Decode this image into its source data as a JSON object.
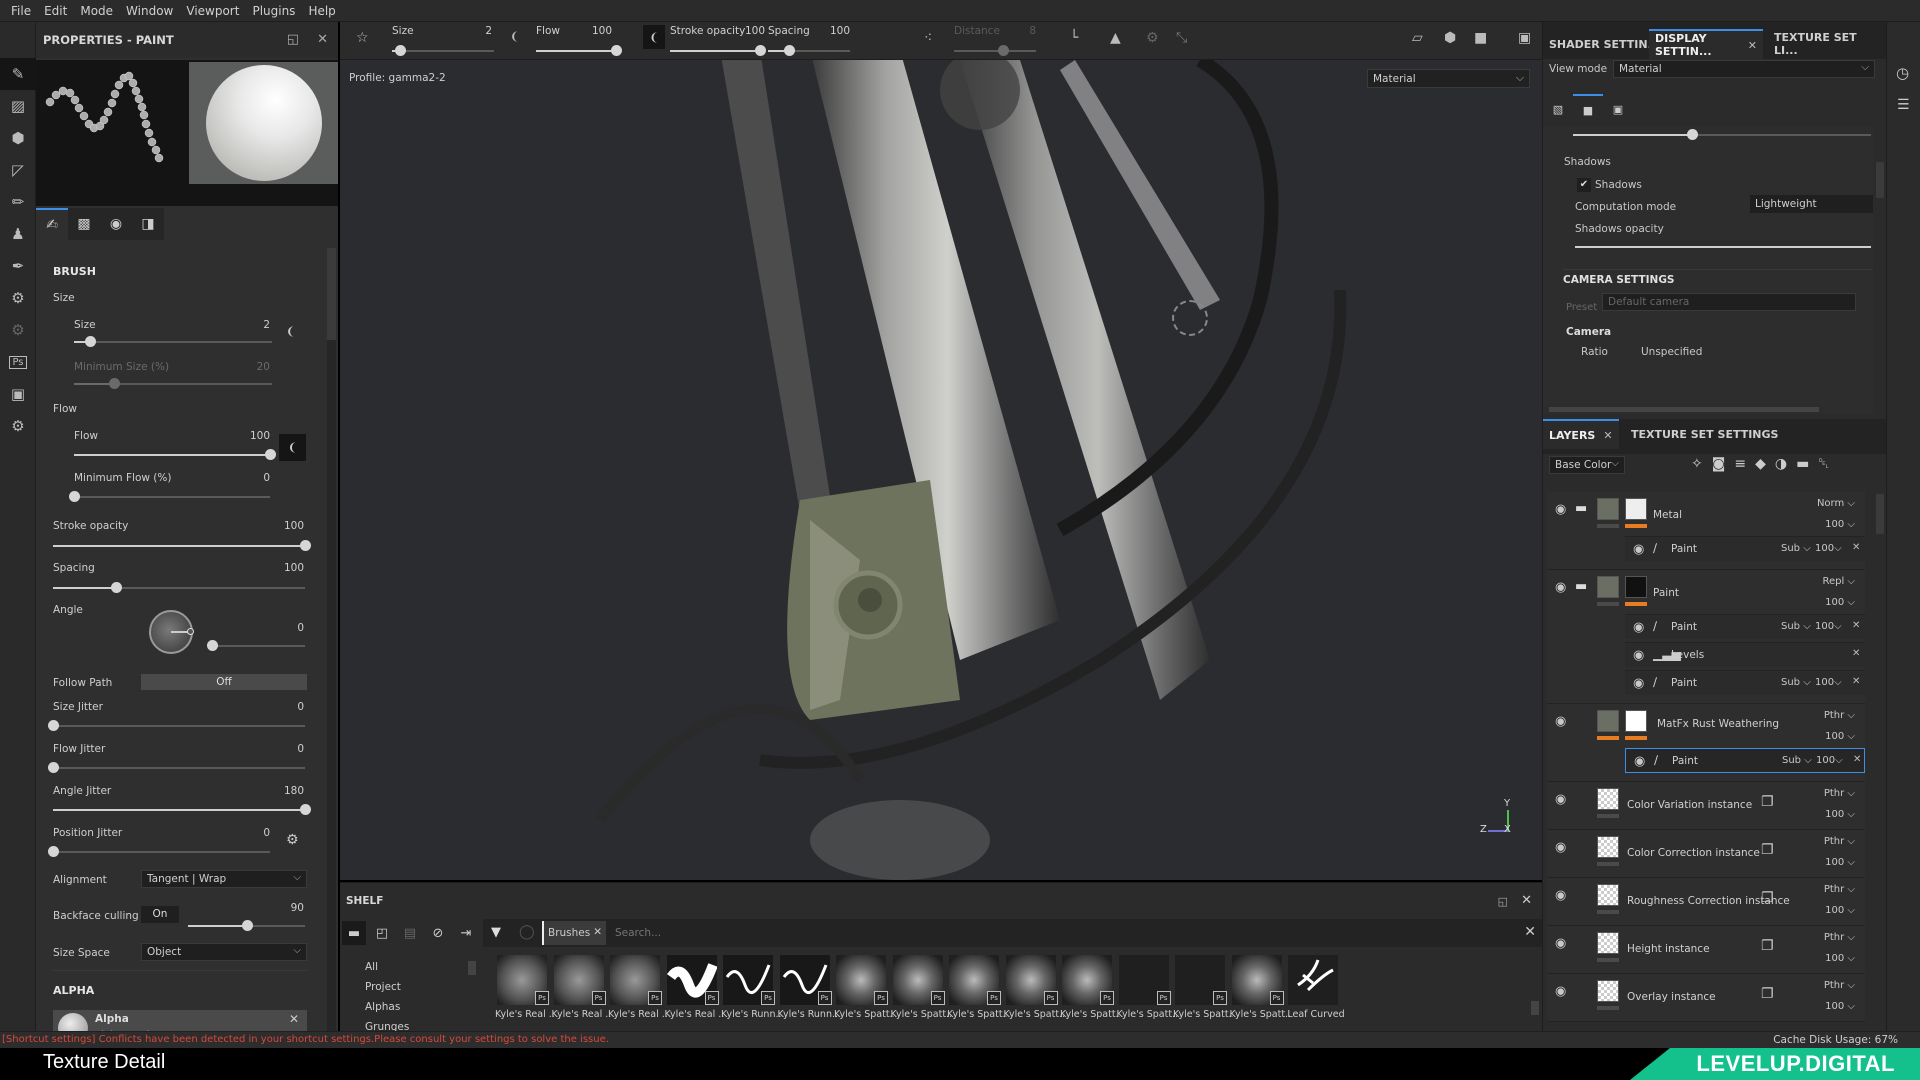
{
  "menu": [
    "File",
    "Edit",
    "Mode",
    "Window",
    "Viewport",
    "Plugins",
    "Help"
  ],
  "left_tools": [
    "paint-brush",
    "eraser",
    "projection",
    "polygon-fill",
    "smudge",
    "clone-stamp",
    "color-picker",
    "plugin-1",
    "plugin-2",
    "photoshop-export",
    "bake",
    "plugin-3"
  ],
  "properties": {
    "title": "PROPERTIES - PAINT",
    "tabs": [
      "brush-tab",
      "alpha-tab",
      "stencil-tab",
      "material-tab"
    ],
    "brush_section": "BRUSH",
    "size_group": "Size",
    "size_label": "Size",
    "size_value": "2",
    "size_frac": 0.08,
    "min_size_label": "Minimum Size (%)",
    "min_size_value": "20",
    "min_size_frac": 0.2,
    "flow_group": "Flow",
    "flow_label": "Flow",
    "flow_value": "100",
    "flow_frac": 1.0,
    "min_flow_label": "Minimum Flow (%)",
    "min_flow_value": "0",
    "min_flow_frac": 0,
    "stroke_opacity_label": "Stroke opacity",
    "stroke_opacity_value": "100",
    "stroke_opacity_frac": 1.0,
    "spacing_label": "Spacing",
    "spacing_value": "100",
    "spacing_frac": 0.25,
    "angle_label": "Angle",
    "angle_value": "0",
    "angle_frac": 0,
    "follow_path_label": "Follow Path",
    "follow_path_value": "Off",
    "size_jitter_label": "Size Jitter",
    "size_jitter_value": "0",
    "size_jitter_frac": 0,
    "flow_jitter_label": "Flow Jitter",
    "flow_jitter_value": "0",
    "flow_jitter_frac": 0,
    "angle_jitter_label": "Angle Jitter",
    "angle_jitter_value": "180",
    "angle_jitter_frac": 1.0,
    "position_jitter_label": "Position Jitter",
    "position_jitter_value": "0",
    "position_jitter_frac": 0,
    "alignment_label": "Alignment",
    "alignment_value": "Tangent | Wrap",
    "backface_label": "Backface culling",
    "backface_toggle": "On",
    "backface_value": "90",
    "backface_frac": 0.5,
    "size_space_label": "Size Space",
    "size_space_value": "Object",
    "alpha_section": "ALPHA",
    "alpha_name": "Alpha",
    "alpha_resource": "alpha_stroke_06"
  },
  "toolbar": {
    "size_label": "Size",
    "size_value": "2",
    "flow_label": "Flow",
    "flow_value": "100",
    "stroke_opacity_label": "Stroke opacity",
    "stroke_opacity_value": "100",
    "spacing_label": "Spacing",
    "spacing_value": "100",
    "distance_label": "Distance",
    "distance_value": "8"
  },
  "viewport": {
    "profile": "Profile: gamma2-2",
    "mode": "Material",
    "axis": {
      "y": "Y",
      "z": "Z",
      "x": "X"
    }
  },
  "shelf": {
    "title": "SHELF",
    "filter_tag": "Brushes",
    "search_placeholder": "Search...",
    "categories": [
      "All",
      "Project",
      "Alphas",
      "Grunges"
    ],
    "items": [
      "Kyle's Real ...",
      "Kyle's Real ...",
      "Kyle's Real ...",
      "Kyle's Real ...",
      "Kyle's Runn...",
      "Kyle's Runn...",
      "Kyle's Spatt...",
      "Kyle's Spatt...",
      "Kyle's Spatt...",
      "Kyle's Spatt...",
      "Kyle's Spatt...",
      "Kyle's Spatt...",
      "Kyle's Spatt...",
      "Kyle's Spatt...",
      "Leaf Curved"
    ]
  },
  "display_settings": {
    "tabs": [
      "SHADER SETTIN...",
      "DISPLAY SETTIN...",
      "TEXTURE SET LI..."
    ],
    "view_mode_label": "View mode",
    "view_mode_value": "Material",
    "shadows_group": "Shadows",
    "shadows_checkbox": "Shadows",
    "computation_label": "Computation mode",
    "computation_value": "Lightweight",
    "shadows_opacity_label": "Shadows opacity",
    "camera_section": "CAMERA SETTINGS",
    "preset_label": "Preset",
    "preset_value": "Default camera",
    "camera_group": "Camera",
    "ratio_label": "Ratio",
    "ratio_value": "Unspecified"
  },
  "layers": {
    "tabs": [
      "LAYERS",
      "TEXTURE SET SETTINGS"
    ],
    "channel": "Base Color",
    "items": [
      {
        "name": "Metal",
        "blend": "Norm",
        "opacity": "100",
        "type": "folder",
        "subs": [
          {
            "name": "Paint",
            "blend": "Sub",
            "opacity": "100"
          }
        ]
      },
      {
        "name": "Paint",
        "blend": "Repl",
        "opacity": "100",
        "type": "folder",
        "subs": [
          {
            "name": "Paint",
            "blend": "Sub",
            "opacity": "100"
          },
          {
            "name": "Levels",
            "blend": "",
            "opacity": ""
          },
          {
            "name": "Paint",
            "blend": "Sub",
            "opacity": "100"
          }
        ]
      },
      {
        "name": "MatFx Rust Weathering",
        "blend": "Pthr",
        "opacity": "100",
        "type": "fill",
        "subs": [
          {
            "name": "Paint",
            "blend": "Sub",
            "opacity": "100"
          }
        ]
      },
      {
        "name": "Color Variation instance",
        "blend": "Pthr",
        "opacity": "100",
        "type": "instance"
      },
      {
        "name": "Color Correction instance",
        "blend": "Pthr",
        "opacity": "100",
        "type": "instance"
      },
      {
        "name": "Roughness Correction instance",
        "blend": "Pthr",
        "opacity": "100",
        "type": "instance"
      },
      {
        "name": "Height instance",
        "blend": "Pthr",
        "opacity": "100",
        "type": "instance"
      },
      {
        "name": "Overlay instance",
        "blend": "Pthr",
        "opacity": "100",
        "type": "instance"
      }
    ]
  },
  "status": {
    "message": "[Shortcut settings] Conflicts have been detected in your shortcut settings.Please consult your settings to solve the issue.",
    "cache": "Cache Disk Usage:   67%"
  },
  "caption": {
    "left": "Texture Detail",
    "brand": "LEVELUP.DIGITAL"
  },
  "colors": {
    "accent": "#3c8ee8",
    "warning": "#d9483b",
    "layer_mask": "#e87c23",
    "brand": "#14c08b"
  }
}
